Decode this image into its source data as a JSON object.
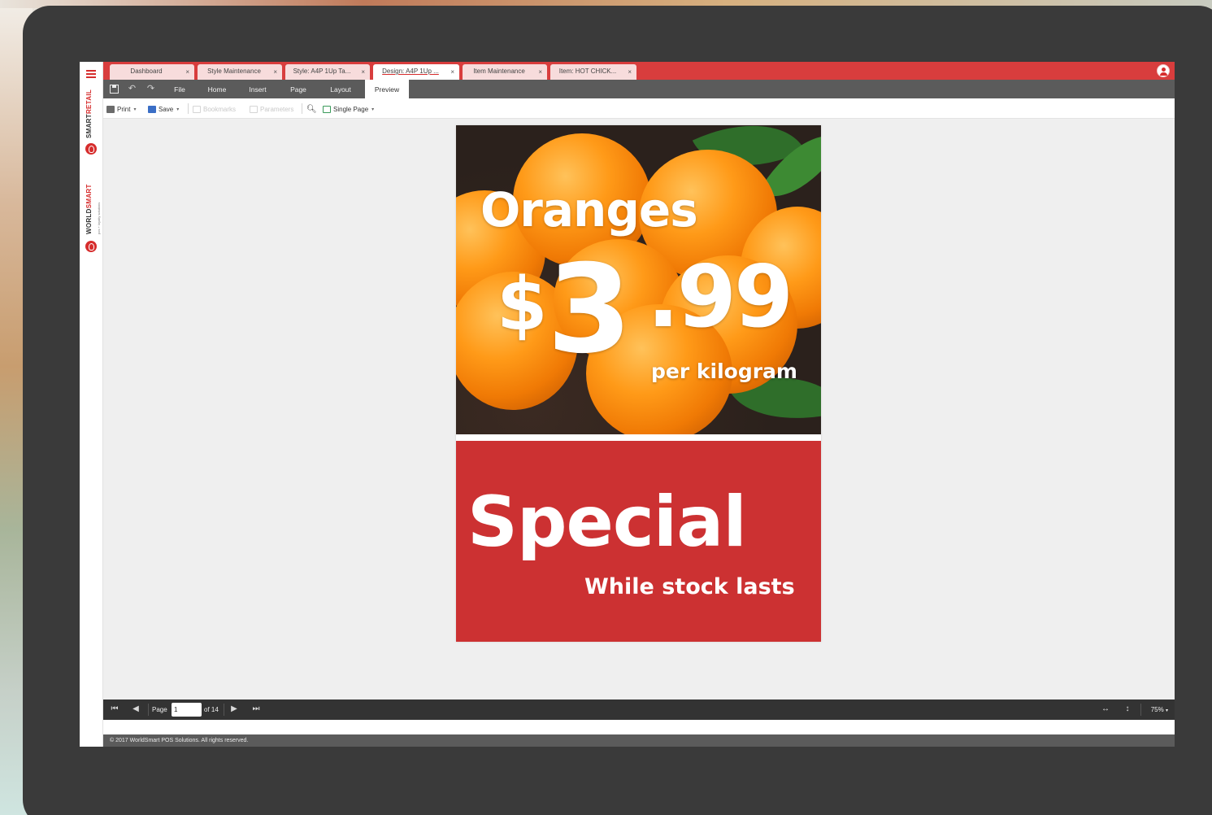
{
  "brand": {
    "product_name_part1": "SMART",
    "product_name_part2": "RETAIL",
    "company_part1": "WORLD",
    "company_part2": "SMART",
    "company_tagline": "pos + loyalty solutions"
  },
  "tabs": [
    {
      "label": "Dashboard",
      "active": false
    },
    {
      "label": "Style Maintenance",
      "active": false
    },
    {
      "label": "Style: A4P 1Up Ta...",
      "active": false
    },
    {
      "label": "Design: A4P 1Up ...",
      "active": true
    },
    {
      "label": "Item Maintenance",
      "active": false
    },
    {
      "label": "Item: HOT CHICK...",
      "active": false
    }
  ],
  "ribbon": {
    "tabs": [
      {
        "label": "File",
        "active": false
      },
      {
        "label": "Home",
        "active": false
      },
      {
        "label": "Insert",
        "active": false
      },
      {
        "label": "Page",
        "active": false
      },
      {
        "label": "Layout",
        "active": false
      },
      {
        "label": "Preview",
        "active": true
      }
    ]
  },
  "toolbar": {
    "print_label": "Print",
    "save_label": "Save",
    "bookmarks_label": "Bookmarks",
    "parameters_label": "Parameters",
    "single_page_label": "Single Page"
  },
  "poster": {
    "title": "Oranges",
    "price_dollar": "$",
    "price_whole": "3",
    "price_cents": ".99",
    "unit": "per kilogram",
    "headline": "Special",
    "subline": "While stock lasts"
  },
  "pager": {
    "page_label": "Page",
    "page_value": "1",
    "of_label": "of 14",
    "zoom": "75%"
  },
  "footer": {
    "copyright": "© 2017 WorldSmart POS Solutions. All rights reserved."
  },
  "colors": {
    "accent": "#d83d3d",
    "poster_red": "#cc3132",
    "ribbon_gray": "#5b5b5b",
    "pager_dark": "#333333"
  }
}
